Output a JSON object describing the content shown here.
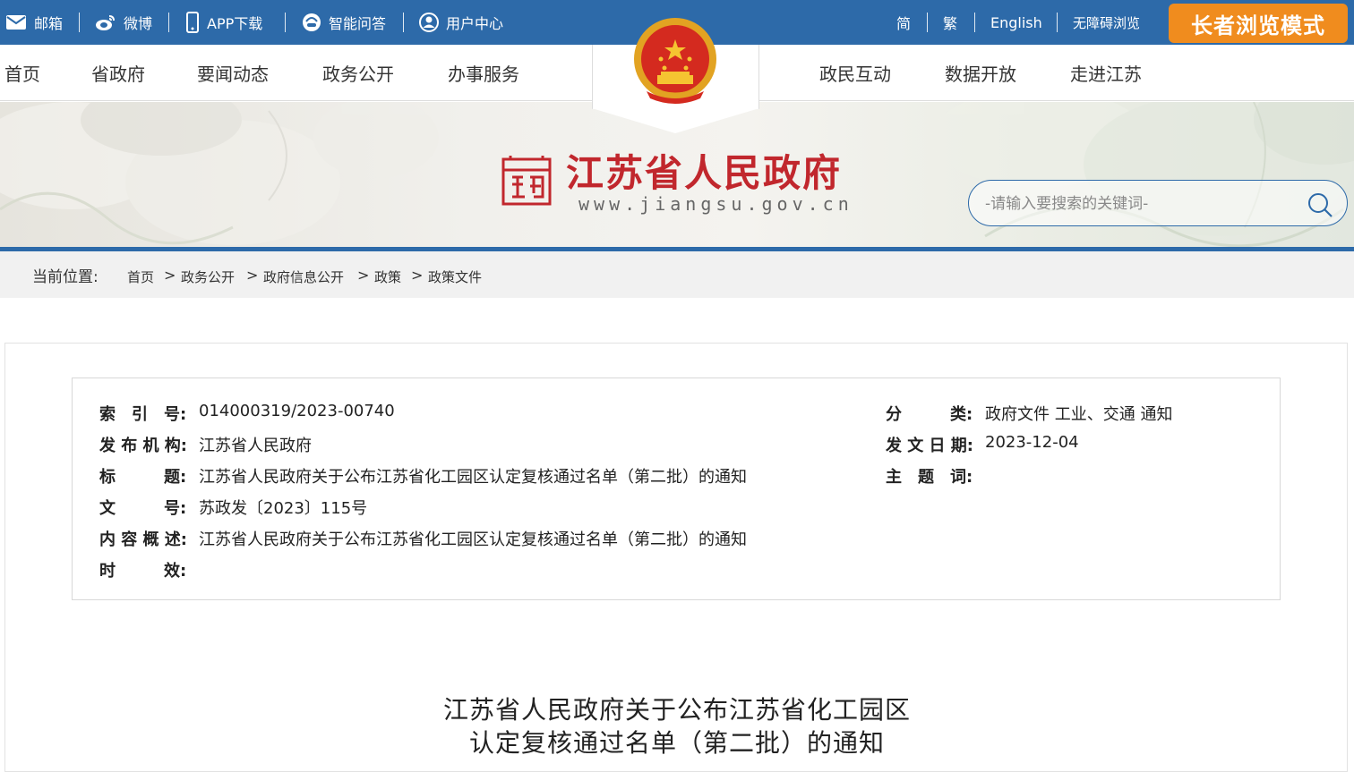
{
  "topbar": {
    "mail": "邮箱",
    "weibo": "微博",
    "app": "APP下载",
    "qa": "智能问答",
    "user": "用户中心",
    "simplified": "简",
    "traditional": "繁",
    "english": "English",
    "accessible": "无障碍浏览",
    "elder_mode": "长者浏览模式"
  },
  "nav": {
    "items_left": [
      "首页",
      "省政府",
      "要闻动态",
      "政务公开",
      "办事服务"
    ],
    "items_right": [
      "政民互动",
      "数据开放",
      "走进江苏"
    ]
  },
  "banner": {
    "site_name": "江苏省人民政府",
    "site_url": "www.jiangsu.gov.cn",
    "search_placeholder": "-请输入要搜索的关键词-"
  },
  "breadcrumb": {
    "label": "当前位置:",
    "items": [
      "首页",
      "政务公开",
      "政府信息公开",
      "政策",
      "政策文件"
    ],
    "separator": ">"
  },
  "meta": {
    "index_label": "索　引　号:",
    "index_value": "014000319/2023-00740",
    "category_label": "分　　　类:",
    "category_value": "政府文件 工业、交通 通知",
    "publisher_label": "发 布 机 构:",
    "publisher_value": "江苏省人民政府",
    "date_label": "发 文 日 期:",
    "date_value": "2023-12-04",
    "title_label": "标　　　题:",
    "title_value": "江苏省人民政府关于公布江苏省化工园区认定复核通过名单（第二批）的通知",
    "subject_label": "主　题　词:",
    "subject_value": "",
    "docno_label": "文　　　号:",
    "docno_value": "苏政发〔2023〕115号",
    "summary_label": "内 容 概 述:",
    "summary_value": "江苏省人民政府关于公布江苏省化工园区认定复核通过名单（第二批）的通知",
    "validity_label": "时　　　效:",
    "validity_value": ""
  },
  "document": {
    "title_line1": "江苏省人民政府关于公布江苏省化工园区",
    "title_line2": "认定复核通过名单（第二批）的通知"
  },
  "colors": {
    "topbar_blue": "#2d6aa9",
    "elder_orange": "#f08c1e",
    "brand_red": "#c1272d"
  }
}
